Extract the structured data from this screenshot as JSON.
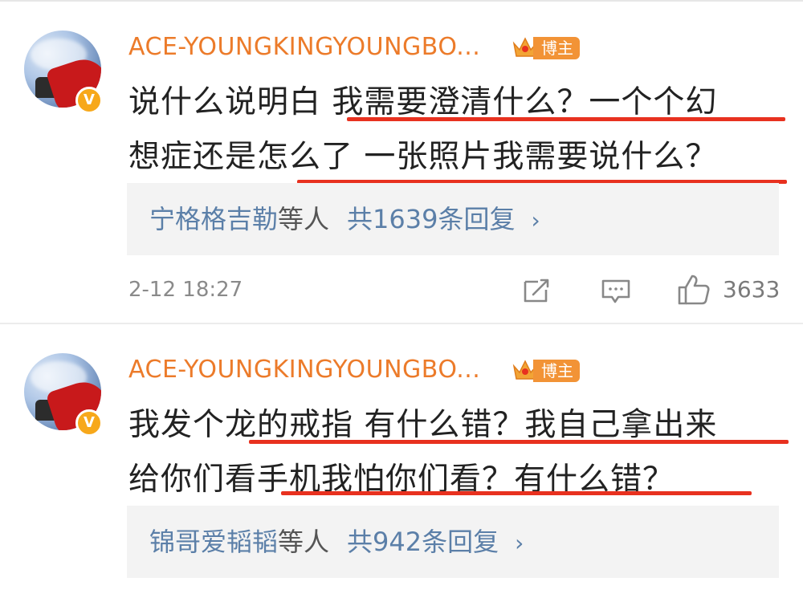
{
  "comments": [
    {
      "username": "ACE-YOUNGKINGYOUNGBO...",
      "host_label": "博主",
      "verify_mark": "V",
      "lines": [
        "说什么说明白 我需要澄清什么？一个个幻",
        "想症还是怎么了 一张照片我需要说什么？"
      ],
      "reply": {
        "names": "宁格格吉勒",
        "etc": "等人",
        "count": "共1639条回复",
        "chevron": "›"
      },
      "time": "2-12 18:27",
      "likes": "3633"
    },
    {
      "username": "ACE-YOUNGKINGYOUNGBO...",
      "host_label": "博主",
      "verify_mark": "V",
      "lines": [
        "我发个龙的戒指 有什么错？我自己拿出来",
        "给你们看手机我怕你们看？有什么错？"
      ],
      "reply": {
        "names": "锦哥爱韬韬",
        "etc": "等人",
        "count": "共942条回复",
        "chevron": "›"
      }
    }
  ],
  "colors": {
    "username": "#ec7b2a",
    "link": "#5b7fa8",
    "underline": "#e8311f",
    "host_tag": "#f29336"
  },
  "icons": [
    "share-icon",
    "comment-icon",
    "like-icon",
    "crown-icon",
    "verified-icon"
  ]
}
